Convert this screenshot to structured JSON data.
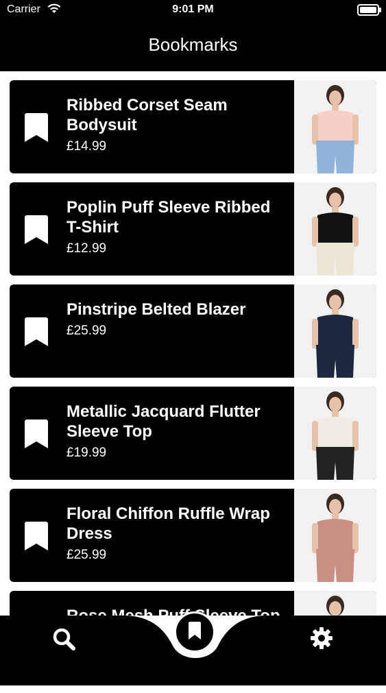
{
  "status_bar": {
    "carrier": "Carrier",
    "time": "9:01 PM"
  },
  "header": {
    "title": "Bookmarks"
  },
  "items": [
    {
      "name": "Ribbed Corset Seam Bodysuit",
      "price": "£14.99",
      "top_color": "#f7cfc7",
      "bottom_color": "#8fb3d9"
    },
    {
      "name": "Poplin Puff Sleeve Ribbed T-Shirt",
      "price": "£12.99",
      "top_color": "#111111",
      "bottom_color": "#ece6d6"
    },
    {
      "name": "Pinstripe Belted Blazer",
      "price": "£25.99",
      "top_color": "#1d2740",
      "bottom_color": "#1d2740"
    },
    {
      "name": "Metallic Jacquard Flutter Sleeve Top",
      "price": "£19.99",
      "top_color": "#efece6",
      "bottom_color": "#222222"
    },
    {
      "name": "Floral Chiffon Ruffle Wrap Dress",
      "price": "£25.99",
      "top_color": "#c98e84",
      "bottom_color": "#c98e84"
    },
    {
      "name": "Rose Mesh Puff Sleeve Top",
      "price": "",
      "top_color": "#1a1a1a",
      "bottom_color": "#1a1a1a"
    }
  ],
  "tabbar": {
    "left_icon": "search-icon",
    "center_icon": "bookmark-icon",
    "right_icon": "gear-icon"
  }
}
